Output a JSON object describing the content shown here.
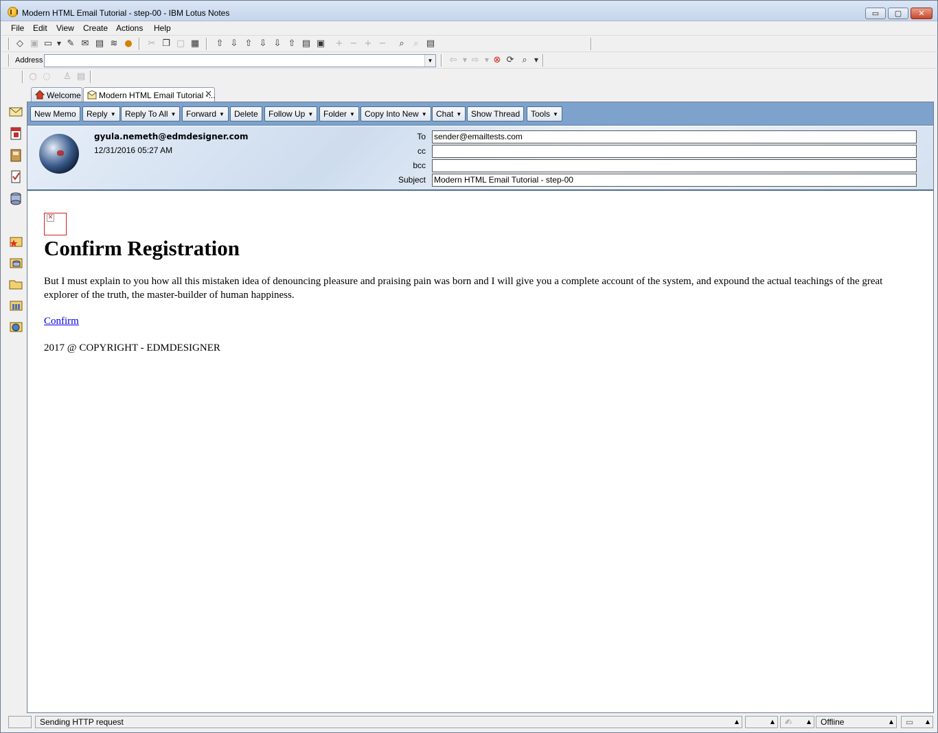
{
  "window": {
    "title": "Modern HTML Email Tutorial - step-00 - IBM Lotus Notes",
    "min_glyph": "▭",
    "max_glyph": "▢",
    "close_glyph": "✕"
  },
  "menu": [
    "File",
    "Edit",
    "View",
    "Create",
    "Actions",
    "Help"
  ],
  "address_bar": {
    "label": "Address",
    "value": ""
  },
  "tabs": [
    {
      "label": "Welcome",
      "icon": "home-icon"
    },
    {
      "label": "Modern HTML Email Tutorial -...",
      "icon": "mail-open-icon",
      "close": "✕"
    }
  ],
  "action_bar": [
    {
      "label": "New Memo",
      "dropdown": false
    },
    {
      "label": "Reply",
      "dropdown": true
    },
    {
      "label": "Reply To All",
      "dropdown": true
    },
    {
      "label": "Forward",
      "dropdown": true
    },
    {
      "label": "Delete",
      "dropdown": false
    },
    {
      "label": "Follow Up",
      "dropdown": true
    },
    {
      "label": "Folder",
      "dropdown": true
    },
    {
      "label": "Copy Into New",
      "dropdown": true
    },
    {
      "label": "Chat",
      "dropdown": true
    },
    {
      "label": "Show Thread",
      "dropdown": false
    },
    {
      "label": "Tools",
      "dropdown": true
    }
  ],
  "message_header": {
    "from": "gyula.nemeth@edmdesigner.com",
    "date": "12/31/2016 05:27 AM",
    "to_label": "To",
    "to_value": "sender@emailtests.com",
    "cc_label": "cc",
    "cc_value": "",
    "bcc_label": "bcc",
    "bcc_value": "",
    "subject_label": "Subject",
    "subject_value": "Modern HTML Email Tutorial - step-00"
  },
  "email_body": {
    "title": "Confirm Registration",
    "paragraph": "But I must explain to you how all this mistaken idea of denouncing pleasure and praising pain was born and I will give you a complete account of the system, and expound the actual teachings of the great explorer of the truth, the master-builder of human happiness.",
    "link": "Confirm",
    "copyright": "2017 @ COPYRIGHT - EDMDESIGNER"
  },
  "status_bar": {
    "message": "Sending HTTP request",
    "location": "Offline"
  },
  "colors": {
    "action_bar": "#7da3cd",
    "link": "#0000ee"
  }
}
